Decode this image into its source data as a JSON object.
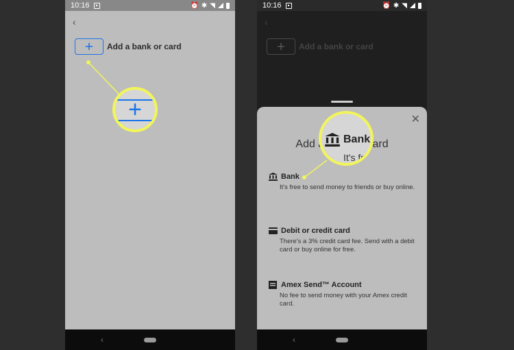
{
  "status": {
    "time": "10:16"
  },
  "left_screen": {
    "back_icon": "back-arrow-icon",
    "add_label": "Add a bank or card",
    "plus_symbol": "+"
  },
  "right_screen": {
    "sheet_title": "Add a bank or card",
    "close_symbol": "✕",
    "options": [
      {
        "title": "Bank",
        "desc": "It's free to send money to friends or buy online.",
        "icon": "bank-icon"
      },
      {
        "title": "Debit or credit card",
        "desc": "There's a 3% credit card fee. Send with a debit card or buy online for free.",
        "icon": "card-icon"
      },
      {
        "title": "Amex Send™ Account",
        "desc": "No fee to send money with your Amex credit card.",
        "icon": "amex-icon"
      }
    ],
    "zoom_title": "Bank",
    "zoom_sub": "It's fre"
  },
  "nav": {
    "back_symbol": "‹"
  },
  "colors": {
    "accent": "#1a73e8",
    "highlight": "#f2f55a"
  }
}
